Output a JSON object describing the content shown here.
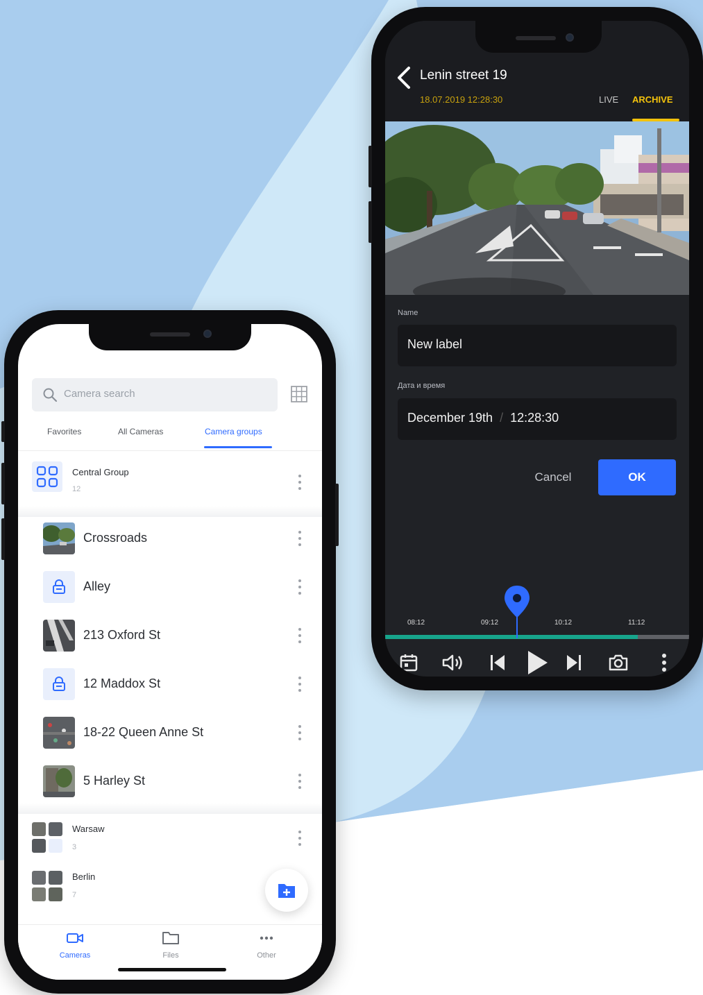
{
  "colors": {
    "accent_blue": "#2f6bff",
    "archive_yellow": "#f3c20c",
    "timeline_green": "#17a58c",
    "bg_blue": "#a9cdee",
    "bg_light_blue": "#cfe8f8"
  },
  "archive_screen": {
    "title": "Lenin street 19",
    "datetime": "18.07.2019 12:28:30",
    "mode_tabs": {
      "live": "LIVE",
      "archive": "ARCHIVE",
      "active": "archive"
    },
    "form": {
      "name_label": "Name",
      "name_value": "New label",
      "datetime_label": "Дата и время",
      "date_value": "December 19th",
      "separator": "/",
      "time_value": "12:28:30"
    },
    "buttons": {
      "cancel": "Cancel",
      "ok": "OK"
    },
    "timeline": {
      "ticks": [
        "08:12",
        "09:12",
        "10:12",
        "11:12"
      ],
      "progress": 0.83
    },
    "controls": [
      {
        "icon": "calendar-icon"
      },
      {
        "icon": "volume-icon"
      },
      {
        "icon": "skip-previous-icon"
      },
      {
        "icon": "play-icon"
      },
      {
        "icon": "skip-next-icon"
      },
      {
        "icon": "camera-snapshot-icon"
      },
      {
        "icon": "more-vertical-icon"
      }
    ]
  },
  "cameras_screen": {
    "search": {
      "placeholder": "Camera search",
      "icon": "search-icon"
    },
    "layout_icon": "grid-icon",
    "tabs": [
      "Favorites",
      "All Cameras",
      "Camera groups"
    ],
    "active_tab": "Camera groups",
    "groups": [
      {
        "name": "Central Group",
        "count": "12",
        "cameras": [
          {
            "name": "Crossroads",
            "thumb": "street"
          },
          {
            "name": "Alley",
            "thumb": "lock"
          },
          {
            "name": "213 Oxford St",
            "thumb": "crosswalk"
          },
          {
            "name": "12 Maddox St",
            "thumb": "lock"
          },
          {
            "name": "18-22 Queen Anne St",
            "thumb": "aerial"
          },
          {
            "name": "5 Harley St",
            "thumb": "building"
          }
        ]
      },
      {
        "name": "Warsaw",
        "count": "3"
      },
      {
        "name": "Berlin",
        "count": "7"
      }
    ],
    "fab_icon": "add-folder-icon",
    "bottom_nav": [
      {
        "label": "Cameras",
        "icon": "video-camera-icon",
        "active": true
      },
      {
        "label": "Files",
        "icon": "folder-icon",
        "active": false
      },
      {
        "label": "Other",
        "icon": "more-horizontal-icon",
        "active": false
      }
    ]
  }
}
